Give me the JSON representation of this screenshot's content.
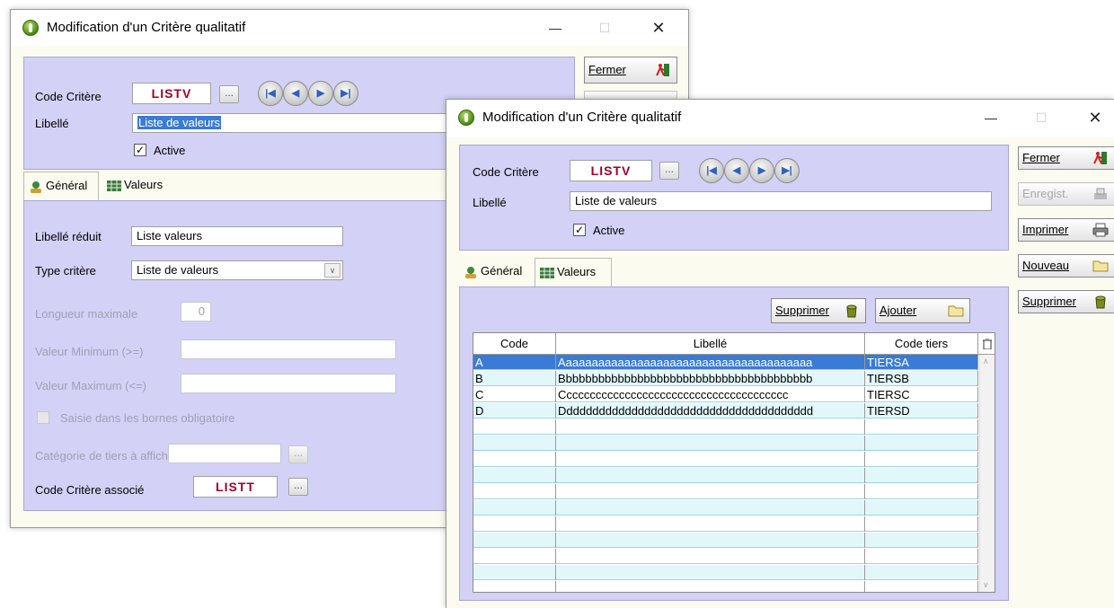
{
  "back_window": {
    "title": "Modification d'un Critère qualitatif",
    "minimize": "—",
    "maximize": "☐",
    "close": "✕",
    "code_label": "Code Critère",
    "code_value": "LISTV",
    "dots": "...",
    "libelle_label": "Libellé",
    "libelle_value": "Liste de valeurs",
    "active_label": "Active",
    "active_check": "✓",
    "close_btn": "Fermer",
    "tabs": [
      {
        "label": "Général"
      },
      {
        "label": "Valeurs"
      }
    ],
    "libelle_reduit_label": "Libellé réduit",
    "libelle_reduit_value": "Liste valeurs",
    "type_label": "Type critère",
    "type_value": "Liste de valeurs",
    "longueur_label": "Longueur maximale",
    "longueur_value": "0",
    "vmin_label": "Valeur Minimum (>=)",
    "vmax_label": "Valeur Maximum (<=)",
    "saisie_label": "Saisie dans les bornes obligatoire",
    "categorie_label": "Catégorie de tiers à afficher",
    "assoc_label": "Code Critère associé",
    "assoc_value": "LISTT"
  },
  "front_window": {
    "title": "Modification d'un Critère qualitatif",
    "minimize": "—",
    "maximize": "☐",
    "close": "✕",
    "code_label": "Code Critère",
    "code_value": "LISTV",
    "dots": "...",
    "libelle_label": "Libellé",
    "libelle_value": "Liste de valeurs",
    "active_label": "Active",
    "active_check": "✓",
    "tabs": [
      {
        "label": "Général"
      },
      {
        "label": "Valeurs"
      }
    ],
    "side_buttons": {
      "fermer": "Fermer",
      "enregistrer": "Enregist.",
      "imprimer": "Imprimer",
      "nouveau": "Nouveau",
      "supprimer": "Supprimer"
    },
    "supprimer_btn": "Supprimer",
    "ajouter_btn": "Ajouter",
    "grid": {
      "columns": [
        "Code",
        "Libellé",
        "Code tiers"
      ],
      "rows": [
        {
          "code": "A",
          "libelle": "Aaaaaaaaaaaaaaaaaaaaaaaaaaaaaaaaaaaaaaa",
          "tiers": "TIERSA"
        },
        {
          "code": "B",
          "libelle": "Bbbbbbbbbbbbbbbbbbbbbbbbbbbbbbbbbbbbbbb",
          "tiers": "TIERSB"
        },
        {
          "code": "C",
          "libelle": "Ccccccccccccccccccccccccccccccccccccccc",
          "tiers": "TIERSC"
        },
        {
          "code": "D",
          "libelle": "Ddddddddddddddddddddddddddddddddddddddd",
          "tiers": "TIERSD"
        }
      ],
      "empty_rows": 12
    }
  },
  "colors": {
    "panel": "#d3d1f5",
    "window_bg": "#fbfbf0",
    "code_red": "#a0002a",
    "selection": "#3a7bd5",
    "grid_alt": "#e2f7f9"
  }
}
